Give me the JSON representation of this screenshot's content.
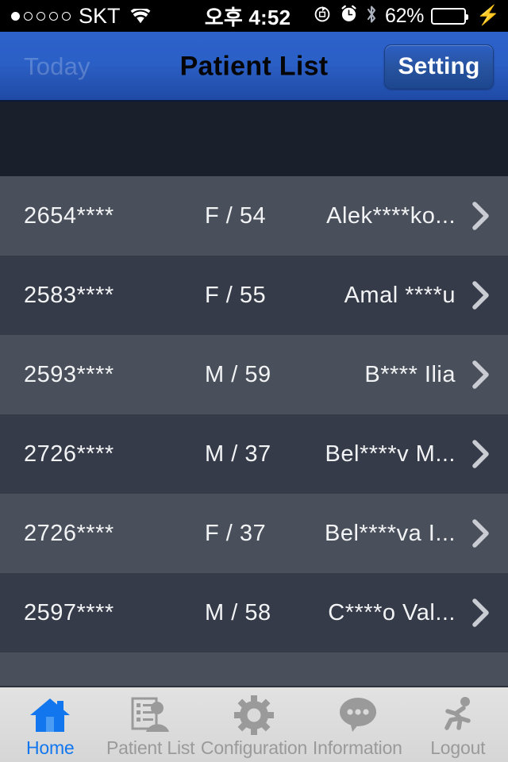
{
  "status_bar": {
    "signal_dots_total": 5,
    "signal_dots_filled": 1,
    "carrier": "SKT",
    "wifi_icon": "wifi-icon",
    "time": "오후 4:52",
    "rotation_lock_icon": "rotation-lock-icon",
    "alarm_icon": "alarm-clock-icon",
    "bluetooth_icon": "bluetooth-icon",
    "battery_percent_label": "62%",
    "battery_percent_value": 62,
    "battery_fill_color": "#4cd964",
    "charging_icon": "lightning-bolt-icon"
  },
  "nav_bar": {
    "back_label": "Today",
    "title": "Patient List",
    "setting_label": "Setting",
    "spinner_icon": "activity-spinner-icon",
    "background_color": "#2a5fc6",
    "title_color": "#050505"
  },
  "list": {
    "columns": [
      "id",
      "sex_age",
      "name"
    ],
    "rows": [
      {
        "id": "2654****",
        "sex_age": "F / 54",
        "name": "Alek****ko...",
        "chevron": "chevron-right-icon"
      },
      {
        "id": "2583****",
        "sex_age": "F / 55",
        "name": "Amal ****u",
        "chevron": "chevron-right-icon"
      },
      {
        "id": "2593****",
        "sex_age": "M / 59",
        "name": "B**** Ilia",
        "chevron": "chevron-right-icon"
      },
      {
        "id": "2726****",
        "sex_age": "M / 37",
        "name": "Bel****v M...",
        "chevron": "chevron-right-icon"
      },
      {
        "id": "2726****",
        "sex_age": "F / 37",
        "name": "Bel****va I...",
        "chevron": "chevron-right-icon"
      },
      {
        "id": "2597****",
        "sex_age": "M / 58",
        "name": "C****o Val...",
        "chevron": "chevron-right-icon"
      }
    ],
    "row_color_odd": "#4a505b",
    "row_color_even": "#353b48",
    "header_band_color": "#1a202b"
  },
  "tab_bar": {
    "active_index": 0,
    "active_color": "#1277ef",
    "inactive_color": "#9a9a9a",
    "items": [
      {
        "label": "Home",
        "icon": "home-icon"
      },
      {
        "label": "Patient List",
        "icon": "patient-list-icon"
      },
      {
        "label": "Configuration",
        "icon": "gear-icon"
      },
      {
        "label": "Information",
        "icon": "speech-bubble-icon"
      },
      {
        "label": "Logout",
        "icon": "running-person-icon"
      }
    ]
  }
}
